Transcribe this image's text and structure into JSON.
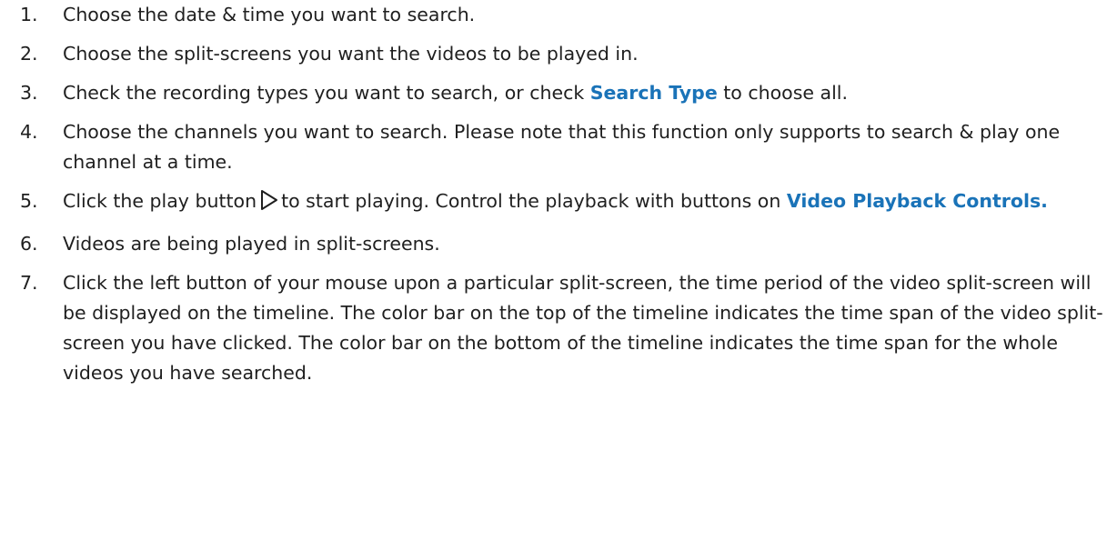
{
  "steps": [
    {
      "number": "1.",
      "text": "Choose the date & time you want to search."
    },
    {
      "number": "2.",
      "text": "Choose the split-screens you want the videos to be played in."
    },
    {
      "number": "3.",
      "before": "Check the recording types you want to search, or check ",
      "link": "Search Type",
      "after": " to choose all."
    },
    {
      "number": "4.",
      "text": "Choose the channels you want to search. Please note that this function only supports to search & play one channel at a time."
    },
    {
      "number": "5.",
      "before": "Click the play button",
      "icon": "play-icon",
      "middle": "to start playing. Control the playback with buttons on ",
      "link": "Video Playback Controls."
    },
    {
      "number": "6.",
      "text": "Videos are being played in split-screens."
    },
    {
      "number": "7.",
      "text": "Click the left button of your mouse upon a particular split-screen, the time period of the video split-screen will be displayed on the timeline. The color bar on the top of the timeline indicates the time span of the video split-screen you have clicked. The color bar on the bottom of the timeline indicates the time span for the whole videos you have searched."
    }
  ],
  "colors": {
    "text": "#1f1f1f",
    "link": "#1a73b8"
  }
}
